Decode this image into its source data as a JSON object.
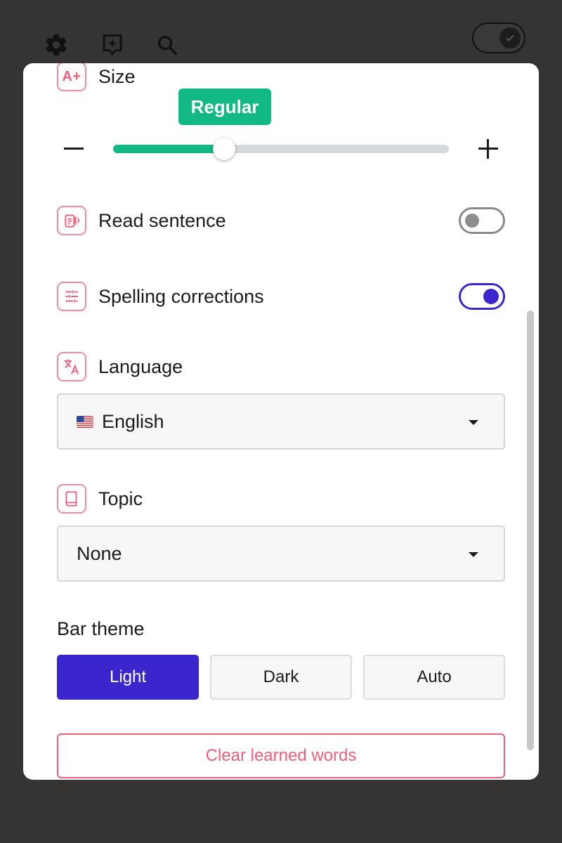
{
  "toolbar": {
    "icons": [
      "gear-icon",
      "assistant-icon",
      "search-icon"
    ],
    "master_toggle_on": true
  },
  "size": {
    "label": "Size",
    "icon_text": "A+",
    "current": "Regular",
    "level": 0.33,
    "minus": "−",
    "plus": "+"
  },
  "read_sentence": {
    "label": "Read sentence",
    "enabled": false
  },
  "spelling": {
    "label": "Spelling corrections",
    "enabled": true
  },
  "language": {
    "label": "Language",
    "selected": "English",
    "flag": "us-flag"
  },
  "topic": {
    "label": "Topic",
    "selected": "None"
  },
  "bar_theme": {
    "label": "Bar theme",
    "options": [
      "Light",
      "Dark",
      "Auto"
    ],
    "selected": "Light"
  },
  "clear_button": "Clear learned words",
  "colors": {
    "accent": "#3b25cc",
    "green": "#12b886",
    "pink": "#ef5f7a",
    "backdrop": "#353433"
  }
}
